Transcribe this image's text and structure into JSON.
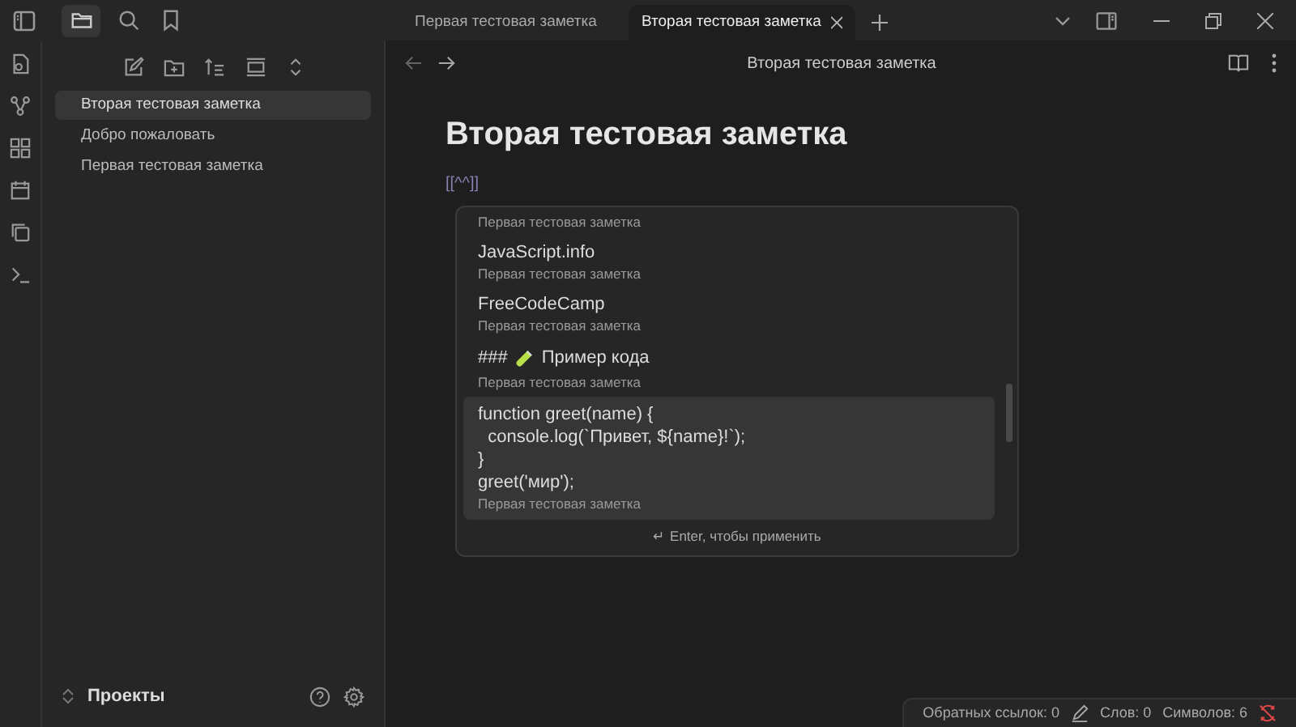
{
  "tabs": [
    {
      "label": "Первая тестовая заметка",
      "selected": false
    },
    {
      "label": "Вторая тестовая заметка",
      "selected": true
    }
  ],
  "sidebar": {
    "items": [
      {
        "label": "Вторая тестовая заметка",
        "selected": true
      },
      {
        "label": "Добро пожаловать",
        "selected": false
      },
      {
        "label": "Первая тестовая заметка",
        "selected": false
      }
    ],
    "vault": "Проекты"
  },
  "editor": {
    "header_title": "Вторая тестовая заметка",
    "title": "Вторая тестовая заметка",
    "line": "[[^^]]"
  },
  "suggestions": {
    "items": [
      {
        "subtitle": "Первая тестовая заметка",
        "selected": false
      },
      {
        "title": "JavaScript.info",
        "subtitle": "Первая тестовая заметка",
        "selected": false
      },
      {
        "title": "FreeCodeCamp",
        "subtitle": "Первая тестовая заметка",
        "selected": false
      },
      {
        "title_prefix": "###",
        "title": "Пример кода",
        "subtitle": "Первая тестовая заметка",
        "selected": false
      },
      {
        "title": "function greet(name) {\n  console.log(`Привет, ${name}!`);\n}\ngreet('мир');",
        "subtitle": "Первая тестовая заметка",
        "selected": true
      }
    ],
    "hint": "↵ Enter, чтобы применить"
  },
  "status_bar": {
    "backlinks": "Обратных ссылок: 0",
    "words": "Слов: 0",
    "chars": "Символов: 6"
  }
}
